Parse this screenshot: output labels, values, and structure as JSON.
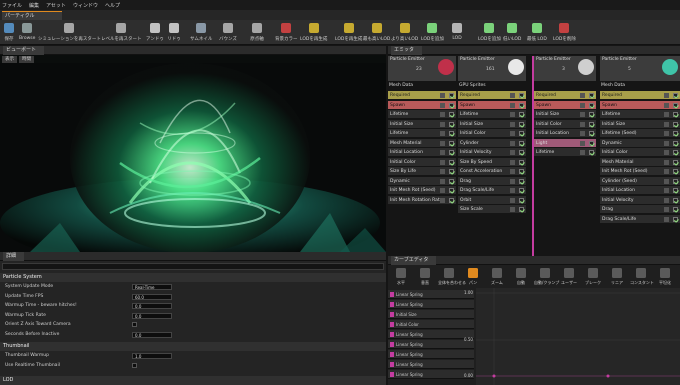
{
  "menu": [
    "ファイル",
    "編集",
    "アセット",
    "ウィンドウ",
    "ヘルプ"
  ],
  "doc_tab": "パーティクル",
  "toolbar": [
    {
      "label": "保存",
      "icon": "save-icon"
    },
    {
      "label": "Browse",
      "icon": "browse-icon"
    },
    {
      "label": "シミュレーションを再スタート",
      "icon": "restart-sim-icon"
    },
    {
      "label": "レベルを再スタート",
      "icon": "restart-level-icon"
    },
    {
      "label": "アンドゥ",
      "icon": "undo-icon"
    },
    {
      "label": "リドゥ",
      "icon": "redo-icon"
    },
    {
      "label": "サムネイル",
      "icon": "thumbnail-icon"
    },
    {
      "label": "バウンズ",
      "icon": "bounds-icon"
    },
    {
      "label": "原点軸",
      "icon": "origin-axis-icon"
    },
    {
      "label": "背景カラー",
      "icon": "bg-color-icon"
    },
    {
      "label": "LODを再生成",
      "icon": "regen-lod-icon"
    },
    {
      "label": "LODを再生成",
      "icon": "regen-lod2-icon"
    },
    {
      "label": "最も高いLOD",
      "icon": "highest-lod-icon"
    },
    {
      "label": "より高いLOD",
      "icon": "higher-lod-icon"
    },
    {
      "label": "LODを追加",
      "icon": "add-lod-icon"
    },
    {
      "label": "LOD",
      "icon": "lod-icon"
    },
    {
      "label": "LODを追加",
      "icon": "add-lod2-icon"
    },
    {
      "label": "低いLOD",
      "icon": "lower-lod-icon"
    },
    {
      "label": "最低 LOD",
      "icon": "lowest-lod-icon"
    },
    {
      "label": "LODを削除",
      "icon": "delete-lod-icon"
    }
  ],
  "viewport": {
    "tab": "ビューポート",
    "btn1": "表示",
    "btn2": "時間"
  },
  "details": {
    "tab": "詳細",
    "section1": "Particle System",
    "rows": [
      {
        "name": "System Update Mode",
        "value": "Real-Time",
        "type": "select"
      },
      {
        "name": "Update Time FPS",
        "value": "60.0",
        "type": "value"
      },
      {
        "name": "Warmup Time - beware hitches!",
        "value": "0.0",
        "type": "value"
      },
      {
        "name": "Warmup Tick Rate",
        "value": "0.0",
        "type": "value"
      },
      {
        "name": "Orient Z Axis Toward Camera",
        "value": "",
        "type": "check"
      },
      {
        "name": "Seconds Before Inactive",
        "value": "0.0",
        "type": "value"
      }
    ],
    "section2": "Thumbnail",
    "rows2": [
      {
        "name": "Thumbnail Warmup",
        "value": "1.0",
        "type": "value"
      },
      {
        "name": "Use Realtime Thumbnail",
        "value": "",
        "type": "check"
      }
    ],
    "section3": "LOD"
  },
  "emitters": {
    "tab": "エミッタ",
    "columns": [
      {
        "title": "Particle Emitter",
        "count": "23",
        "type": "Mesh Data",
        "thumb": "#c0304a",
        "modules": [
          "Required",
          "Spawn",
          "Lifetime",
          "Initial Size",
          "Lifetime",
          "Mesh Material",
          "Initial Location",
          "Initial Color",
          "Size By Life",
          "Dynamic",
          "Init Mesh Rot (Seed)",
          "Init Mesh Rotation Rate"
        ]
      },
      {
        "title": "Particle Emitter",
        "count": "161",
        "type": "GPU Sprites",
        "thumb": "#e8e8e8",
        "modules": [
          "Required",
          "Spawn",
          "Lifetime",
          "Initial Size",
          "Initial Color",
          "Cylinder",
          "Initial Velocity",
          "Size By Speed",
          "Const Acceleration",
          "Drag",
          "Drag Scale/Life",
          "Orbit",
          "Size Scale"
        ]
      },
      {
        "title": "Particle Emitter",
        "count": "3",
        "type": "",
        "thumb": "#cfcfcf",
        "modules": [
          "Required",
          "Spawn",
          "Initial Size",
          "Initial Color",
          "Initial Location",
          "Light",
          "Lifetime"
        ]
      },
      {
        "title": "Particle Emitter",
        "count": "5",
        "type": "Mesh Data",
        "thumb": "#3fc4a8",
        "modules": [
          "Required",
          "Spawn",
          "Lifetime",
          "Initial Size",
          "Lifetime (Seed)",
          "Dynamic",
          "Initial Color",
          "Mesh Material",
          "Init Mesh Rot (Seed)",
          "Cylinder (Seed)",
          "Initial Location",
          "Initial Velocity",
          "Drag",
          "Drag Scale/Life"
        ]
      }
    ]
  },
  "curve_editor": {
    "tab": "カーブエディタ",
    "tools": [
      "水平",
      "垂直",
      "全体を合わせる",
      "パン",
      "ズーム",
      "自動",
      "自動/クランプ",
      "ユーザー",
      "ブレーク",
      "リニア",
      "コンスタント",
      "平坦化"
    ],
    "tracks": [
      "Linear Spring",
      "Linear Spring",
      "Initial Size",
      "Initial Color",
      "Linear Spring",
      "Linear Spring",
      "Linear Spring",
      "Linear Spring",
      "Linear Spring"
    ],
    "axis_labels": [
      "1.00",
      "0.50",
      "0.00"
    ]
  },
  "colors": {
    "accent": "#e08a1f",
    "required": "#a89f4a",
    "spawn": "#b85a5a",
    "sel_magenta": "#c43ca0",
    "green_check": "#8ee07a"
  }
}
